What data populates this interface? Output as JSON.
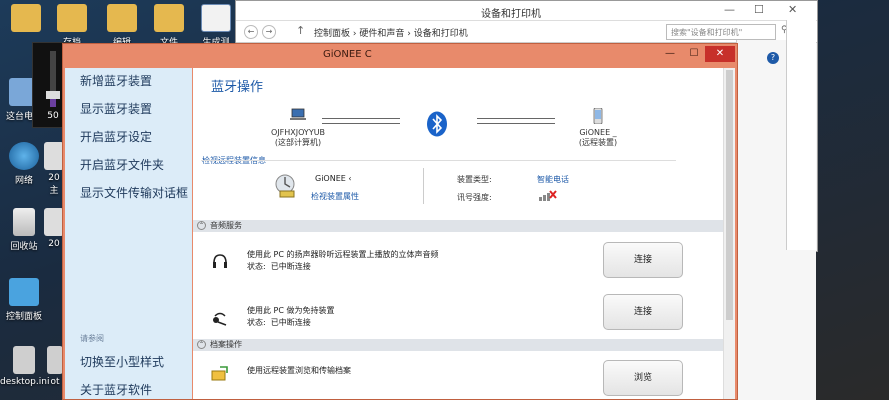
{
  "desktop": {
    "icons": [
      {
        "label": ""
      },
      {
        "label": "存档"
      },
      {
        "label": "编辑"
      },
      {
        "label": "文件"
      },
      {
        "label": "生成测"
      },
      {
        "label": "这台电脑"
      },
      {
        "label": "网络"
      },
      {
        "label": "20"
      },
      {
        "label": "主"
      },
      {
        "label": "回收站"
      },
      {
        "label": "20"
      },
      {
        "label": "控制面板"
      },
      {
        "label": "desktop.ini"
      },
      {
        "label": "ot"
      }
    ],
    "volume": {
      "value": "50",
      "level_percent": 50
    }
  },
  "explorer": {
    "title": "设备和打印机",
    "breadcrumb": [
      "控制面板",
      "硬件和声音",
      "设备和打印机"
    ],
    "separator": "›",
    "search_placeholder": "搜索\"设备和打印机\"",
    "minimize": "—",
    "restore": "☐",
    "close": "✕",
    "help": "?"
  },
  "bt_window": {
    "title": "GiONEE C",
    "minimize": "—",
    "maximize": "☐",
    "close": "✕",
    "sidebar": {
      "items": [
        "新增蓝牙装置",
        "显示蓝牙装置",
        "开启蓝牙设定",
        "开启蓝牙文件夹",
        "显示文件传输对话框"
      ],
      "see_also": "请参阅",
      "bottom_items": [
        "切换至小型样式",
        "关于蓝牙软件"
      ]
    },
    "content": {
      "heading": "蓝牙操作",
      "local_device": {
        "name": "OJFHXJOYYUB",
        "role": "(这部计算机)"
      },
      "remote_device": {
        "name": "GiONEE _",
        "role": "(远程装置)"
      },
      "view_remote_info": "检视远程装置信息",
      "device_name": "GiONEE ‹",
      "view_properties": "检视装置属性",
      "device_type_label": "装置类型:",
      "device_type_value": "智能电话",
      "signal_label": "讯号强度:",
      "sections": [
        {
          "title": "音频服务",
          "services": [
            {
              "name": "使用此 PC 的扬声器聆听远程装置上播放的立体声音频",
              "status_label": "状态:",
              "status": "已中断连接",
              "button": "连接"
            },
            {
              "name": "使用此 PC 做为免持装置",
              "status_label": "状态:",
              "status": "已中断连接",
              "button": "连接"
            }
          ]
        },
        {
          "title": "档案操作",
          "services": [
            {
              "name": "使用远程装置浏览和传输档案",
              "button": "浏览"
            }
          ]
        }
      ]
    }
  },
  "colors": {
    "bt_frame": "#e88a6b",
    "sidebar": "#dcecf8",
    "link": "#1e5aa8",
    "close": "#c7302a"
  }
}
